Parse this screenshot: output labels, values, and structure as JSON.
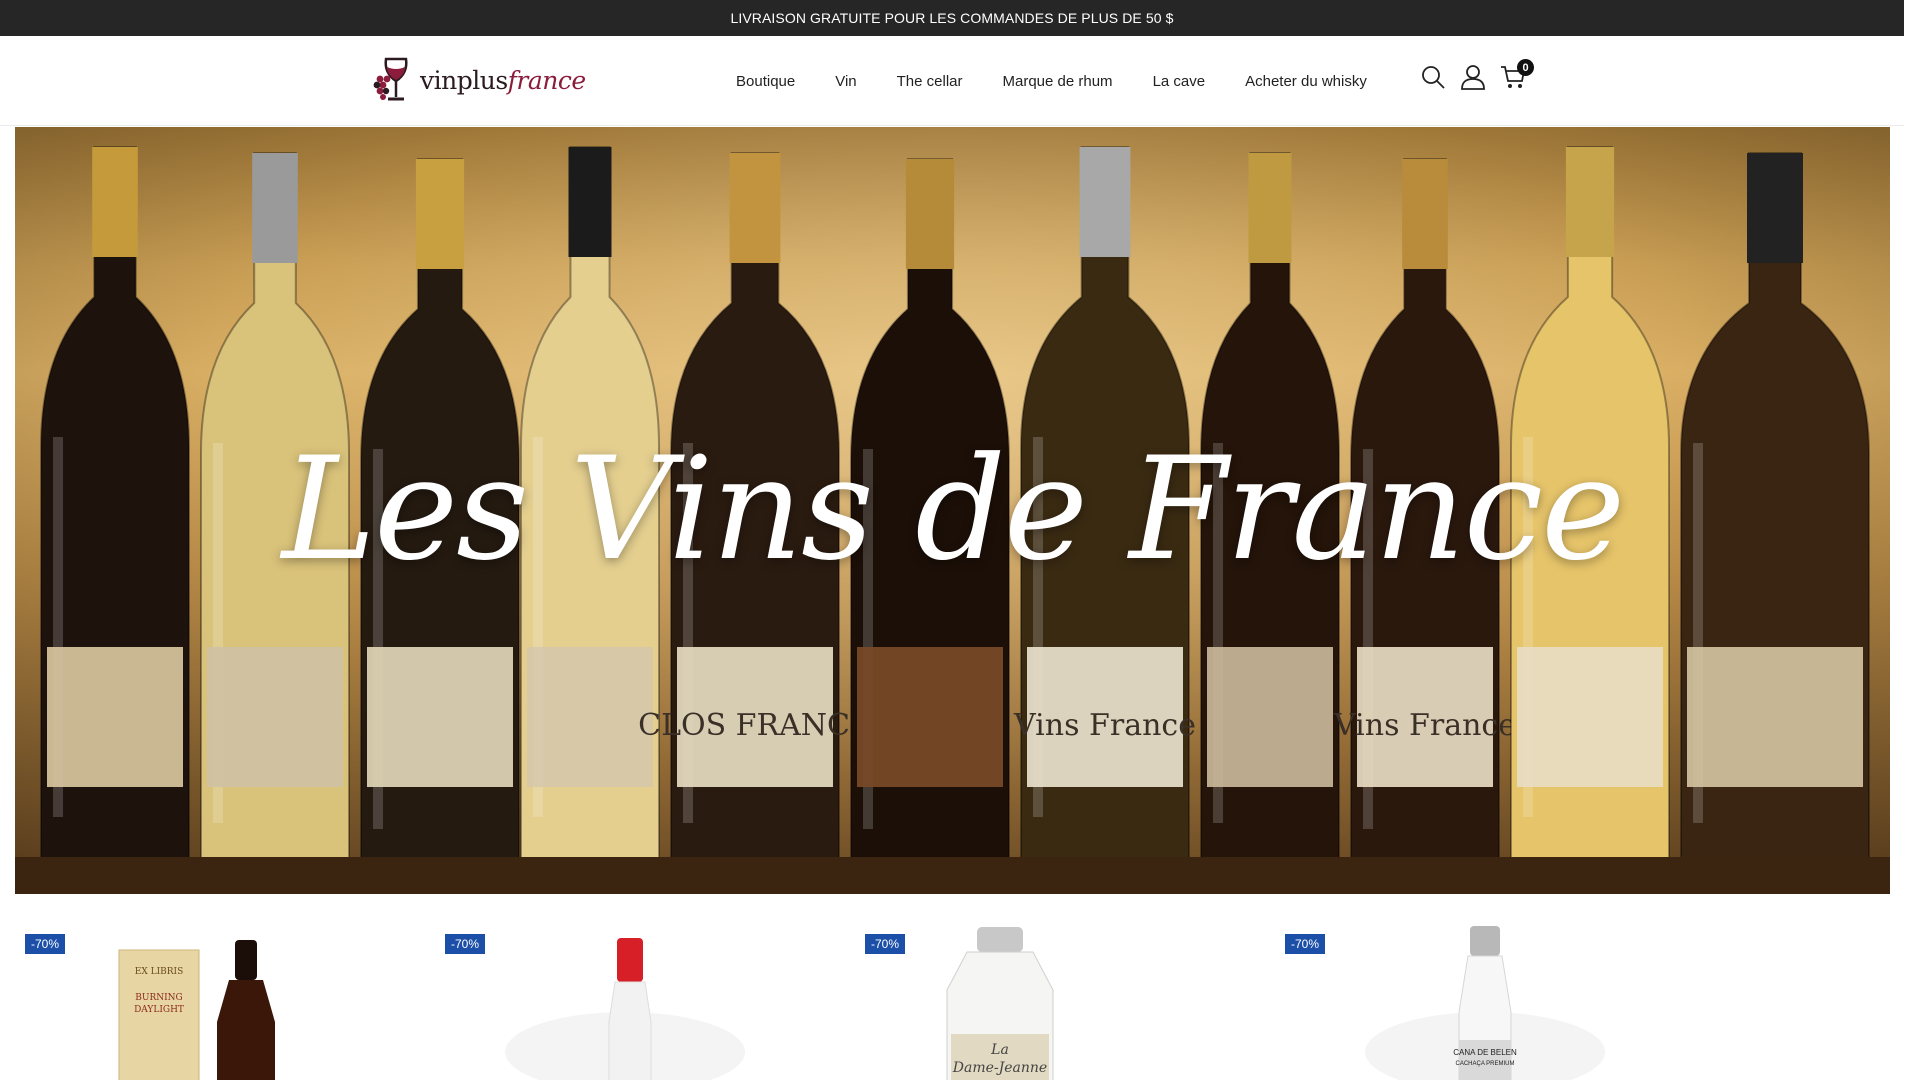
{
  "announcement": "LIVRAISON GRATUITE POUR LES COMMANDES DE PLUS DE 50 $",
  "logo": {
    "brand_main": "vinplus",
    "brand_accent": "france"
  },
  "nav": [
    {
      "label": "Boutique"
    },
    {
      "label": "Vin"
    },
    {
      "label": "The cellar"
    },
    {
      "label": "Marque de rhum"
    },
    {
      "label": "La cave"
    },
    {
      "label": "Acheter du whisky"
    }
  ],
  "header_icons": {
    "search": "search-icon",
    "account": "user-icon",
    "cart": "cart-icon",
    "cart_count": "0"
  },
  "hero": {
    "title": "Les Vins de France",
    "bottle_labels": [
      "CLOS FRANCE",
      "Vins France",
      "Vins France"
    ]
  },
  "products": [
    {
      "badge": "-70%",
      "label_lines": [
        "EX LIBRIS",
        "BURNING",
        "DAYLIGHT"
      ]
    },
    {
      "badge": "-70%",
      "label_lines": []
    },
    {
      "badge": "-70%",
      "label_lines": [
        "La",
        "Dame-Jeanne"
      ]
    },
    {
      "badge": "-70%",
      "label_lines": [
        "CANA DE BELEN",
        "CACHAÇA PREMIUM"
      ]
    }
  ],
  "colors": {
    "topbar": "#262626",
    "badge": "#1b4fa8",
    "brand_accent": "#8c1c3c"
  }
}
